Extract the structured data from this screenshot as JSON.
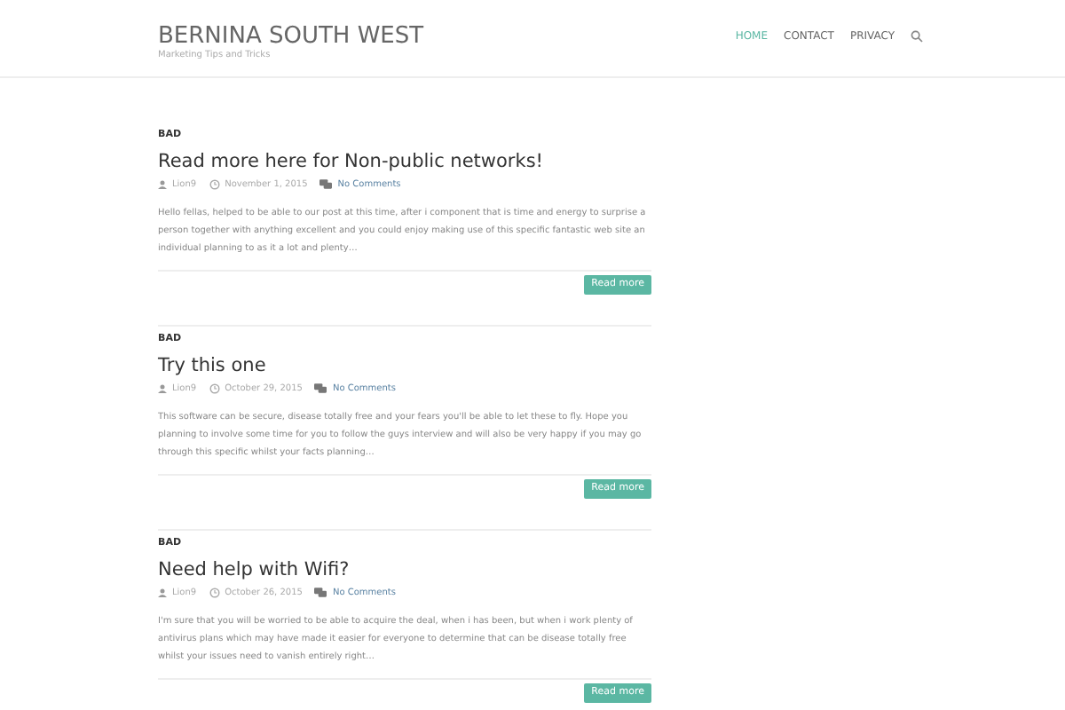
{
  "site": {
    "title": "BERNINA SOUTH WEST",
    "tagline": "Marketing Tips and Tricks"
  },
  "nav": [
    {
      "label": "HOME",
      "selected": true
    },
    {
      "label": "CONTACT",
      "selected": false
    },
    {
      "label": "PRIVACY",
      "selected": false
    }
  ],
  "posts": [
    {
      "category": "BAD",
      "title": "Read more here for Non-public networks!",
      "author": "Lion9",
      "date": "November 1, 2015",
      "comments": "No Comments",
      "excerpt": "Hello fellas, helped to be able to our post at this time, after i component that is time and energy to surprise a person together with anything excellent and you could enjoy making use of this specific fantastic web site an individual planning to as it a lot and plenty…",
      "button": "Read more"
    },
    {
      "category": "BAD",
      "title": "Try this one",
      "author": "Lion9",
      "date": "October 29, 2015",
      "comments": "No Comments",
      "excerpt": "This software can be secure, disease totally free and your fears you'll be able to let these to fly. Hope you planning to involve some time for you to follow the guys interview and will also be very happy if you may go through this specific whilst your facts planning…",
      "button": "Read more"
    },
    {
      "category": "BAD",
      "title": "Need help with Wifi?",
      "author": "Lion9",
      "date": "October 26, 2015",
      "comments": "No Comments",
      "excerpt": "I'm sure that you will be worried to be able to acquire the deal, when i has been, but when i work plenty of antivirus plans which may have made it easier for everyone to determine that can be disease totally free whilst your issues need to vanish entirely right…",
      "button": "Read more"
    }
  ]
}
